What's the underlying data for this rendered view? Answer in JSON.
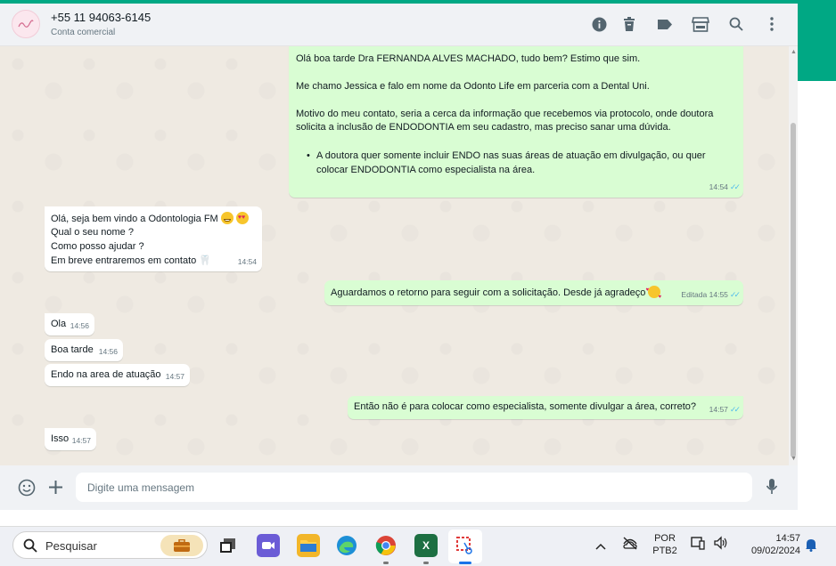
{
  "header": {
    "contact_name": "+55 11 94063-6145",
    "contact_subtitle": "Conta comercial"
  },
  "messages": {
    "m1": {
      "p1": "Olá boa tarde Dra FERNANDA ALVES MACHADO, tudo bem? Estimo que sim.",
      "p2": "Me chamo Jessica e falo em nome da Odonto Life em parceria com a Dental Uni.",
      "p3a": "Motivo do meu contato, seria a cerca da informação que recebemos via protocolo, onde doutora",
      "p3b": "solicita a inclusão de ENDODONTIA em seu cadastro, mas preciso sanar uma dúvida.",
      "bullet_a": "A doutora quer somente incluir ENDO nas suas áreas de atuação em divulgação, ou quer",
      "bullet_b": "colocar ENDODONTIA como especialista na área.",
      "time": "14:54"
    },
    "m2": {
      "l1": "Olá, seja bem vindo a Odontologia FM",
      "l2": "Qual o seu nome ?",
      "l3": "Como posso ajudar ?",
      "l4": "Em breve entraremos em contato",
      "time": "14:54"
    },
    "m3": {
      "text": "Aguardamos o retorno para seguir com a solicitação. Desde já agradeço",
      "edited": "Editada",
      "time": "14:55"
    },
    "m4": {
      "text": "Ola",
      "time": "14:56"
    },
    "m5": {
      "text": "Boa tarde",
      "time": "14:56"
    },
    "m6": {
      "text": "Endo na area de atuação",
      "time": "14:57"
    },
    "m7": {
      "text": "Então não é para colocar como especialista, somente divulgar a área, correto?",
      "time": "14:57"
    },
    "m8": {
      "text": "Isso",
      "time": "14:57"
    }
  },
  "composer": {
    "placeholder": "Digite uma mensagem"
  },
  "taskbar": {
    "search_label": "Pesquisar",
    "lang_top": "POR",
    "lang_bottom": "PTB2",
    "clock_time": "14:57",
    "clock_date": "09/02/2024"
  },
  "colors": {
    "accent": "#00a884",
    "outgoing_bubble": "#d9fdd3",
    "incoming_bubble": "#ffffff",
    "chat_bg": "#efeae2",
    "read_ticks": "#53bdeb"
  },
  "icons": [
    "info-icon",
    "trash-icon",
    "label-icon",
    "store-icon",
    "search-icon",
    "menu-icon",
    "emoji-icon",
    "plus-icon",
    "mic-icon"
  ]
}
